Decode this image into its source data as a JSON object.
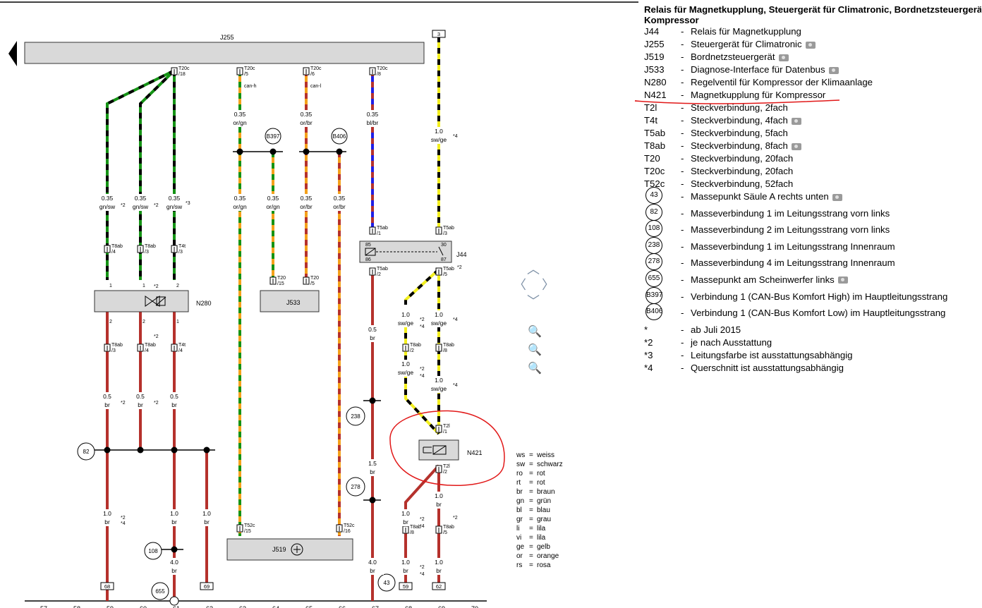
{
  "legend": {
    "title_line1": "Relais für Magnetkupplung, Steuergerät für Climatronic, Bordnetzsteuergerät",
    "title_line2": "Kompressor",
    "dash": "-",
    "items": [
      {
        "code": "J44",
        "desc": "Relais für Magnetkupplung",
        "photo": false
      },
      {
        "code": "J255",
        "desc": "Steuergerät für Climatronic",
        "photo": true
      },
      {
        "code": "J519",
        "desc": "Bordnetzsteuergerät",
        "photo": true
      },
      {
        "code": "J533",
        "desc": "Diagnose-Interface für Datenbus",
        "photo": true
      },
      {
        "code": "N280",
        "desc": "Regelventil für Kompressor der Klimaanlage",
        "photo": false
      },
      {
        "code": "N421",
        "desc": "Magnetkupplung für Kompressor",
        "photo": false
      },
      {
        "code": "T2l",
        "desc": "Steckverbindung, 2fach",
        "photo": false
      },
      {
        "code": "T4t",
        "desc": "Steckverbindung, 4fach",
        "photo": true
      },
      {
        "code": "T5ab",
        "desc": "Steckverbindung, 5fach",
        "photo": false
      },
      {
        "code": "T8ab",
        "desc": "Steckverbindung, 8fach",
        "photo": true
      },
      {
        "code": "T20",
        "desc": "Steckverbindung, 20fach",
        "photo": false
      },
      {
        "code": "T20c",
        "desc": "Steckverbindung, 20fach",
        "photo": false
      },
      {
        "code": "T52c",
        "desc": "Steckverbindung, 52fach",
        "photo": false
      }
    ],
    "ground_items": [
      {
        "code": "43",
        "desc": "Massepunkt Säule A rechts unten",
        "photo": true
      },
      {
        "code": "82",
        "desc": "Masseverbindung 1 im Leitungsstrang vorn links",
        "photo": false
      },
      {
        "code": "108",
        "desc": "Masseverbindung 2 im Leitungsstrang vorn links",
        "photo": false
      },
      {
        "code": "238",
        "desc": "Masseverbindung 1 im Leitungsstrang Innenraum",
        "photo": false
      },
      {
        "code": "278",
        "desc": "Masseverbindung 4 im Leitungsstrang Innenraum",
        "photo": false
      },
      {
        "code": "655",
        "desc": "Massepunkt am Scheinwerfer links",
        "photo": true
      },
      {
        "code": "B397",
        "desc": "Verbindung 1 (CAN-Bus Komfort High) im Hauptleitungsstrang",
        "photo": false
      },
      {
        "code": "B406",
        "desc": "Verbindung 1 (CAN-Bus Komfort Low) im Hauptleitungsstrang",
        "photo": false
      }
    ],
    "notes": [
      {
        "code": "*",
        "desc": "ab Juli 2015"
      },
      {
        "code": "*2",
        "desc": "je nach Ausstattung"
      },
      {
        "code": "*3",
        "desc": "Leitungsfarbe ist ausstattungsabhängig"
      },
      {
        "code": "*4",
        "desc": "Querschnitt ist ausstattungsabhängig"
      }
    ]
  },
  "color_key": [
    {
      "abbr": "ws",
      "name": "weiss"
    },
    {
      "abbr": "sw",
      "name": "schwarz"
    },
    {
      "abbr": "ro",
      "name": "rot"
    },
    {
      "abbr": "rt",
      "name": "rot"
    },
    {
      "abbr": "br",
      "name": "braun"
    },
    {
      "abbr": "gn",
      "name": "grün"
    },
    {
      "abbr": "bl",
      "name": "blau"
    },
    {
      "abbr": "gr",
      "name": "grau"
    },
    {
      "abbr": "li",
      "name": "lila"
    },
    {
      "abbr": "vi",
      "name": "lila"
    },
    {
      "abbr": "ge",
      "name": "gelb"
    },
    {
      "abbr": "or",
      "name": "orange"
    },
    {
      "abbr": "rs",
      "name": "rosa"
    }
  ],
  "diagram": {
    "components": {
      "j255": "J255",
      "j533": "J533",
      "j519": "J519",
      "j44": "J44",
      "n280": "N280",
      "n421": "N421"
    },
    "top_refs": {
      "r3": "3"
    },
    "bottom_refs": {
      "r68": "68",
      "r69": "69",
      "r59": "59",
      "r62": "62"
    },
    "grounds": {
      "g82": "82",
      "g108": "108",
      "g655": "655",
      "g238": "238",
      "g278": "278",
      "g43": "43"
    },
    "splices": {
      "b397": "B397",
      "b406": "B406"
    },
    "conn": {
      "t20c_18_a": "T20c",
      "t20c_18_b": "/18",
      "t20c_5_a": "T20c",
      "t20c_5_b": "/5",
      "t20c_5_c": "can-h",
      "t20c_6_a": "T20c",
      "t20c_6_b": "/6",
      "t20c_6_c": "can-l",
      "t20c_8_a": "T20c",
      "t20c_8_b": "/8",
      "t8ab_4": "T8ab",
      "t8ab_4_p": "/4",
      "t8ab_3": "T8ab",
      "t8ab_3_p": "/3",
      "t4t_3": "T4t",
      "t4t_3_p": "/3",
      "t8ab_3b": "T8ab",
      "t8ab_3b_p": "/3",
      "t8ab_4b": "T8ab",
      "t8ab_4b_p": "/4",
      "t4t_4": "T4t",
      "t4t_4_p": "/4",
      "t20_15": "T20",
      "t20_15_p": "/15",
      "t20_5": "T20",
      "t20_5_p": "/5",
      "t5ab_1": "T5ab",
      "t5ab_1_p": "/1",
      "t5ab_3": "T5ab",
      "t5ab_3_p": "/3",
      "t5ab_2": "T5ab",
      "t5ab_2_p": "/2",
      "t5ab_5": "T5ab",
      "t5ab_5_p": "/5",
      "t8ab_2": "T8ab",
      "t8ab_2_p": "/2",
      "t8ab_8": "T8ab",
      "t8ab_8_p": "/8",
      "t2l_1": "T2l",
      "t2l_1_p": "/1",
      "t2l_2": "T2l",
      "t2l_2_p": "/2",
      "t8ab_8b": "T8ab",
      "t8ab_8b_p": "/8",
      "t8ab_5": "T8ab",
      "t8ab_5_p": "/5",
      "t52c_15": "T52c",
      "t52c_15_p": "/15",
      "t52c_16": "T52c",
      "t52c_16_p": "/16"
    },
    "pins": {
      "p85": "85",
      "p86": "86",
      "p30": "30",
      "p87": "87",
      "n280_1a": "1",
      "n280_1b": "1",
      "n280_2": "2",
      "n280_2a": "2",
      "n280_2b": "2",
      "n280_1c": "1"
    },
    "wires": {
      "w1_s": "0.35",
      "w1_c": "gn/sw",
      "w2_s": "0.35",
      "w2_c": "gn/sw",
      "w3_s": "0.35",
      "w3_c": "gn/sw",
      "w4_s": "0.35",
      "w4_c": "or/gn",
      "w5_s": "0.35",
      "w5_c": "or/br",
      "w6_s": "0.35",
      "w6_c": "bl/br",
      "w7_s": "0.35",
      "w7_c": "or/gn",
      "w8_s": "0.35",
      "w8_c": "or/gn",
      "w9_s": "0.35",
      "w9_c": "or/br",
      "w10_s": "0.35",
      "w10_c": "or/br",
      "w11_s": "1.0",
      "w11_c": "sw/ge",
      "w12_s": "0.5",
      "w12_c": "br",
      "w13_s": "0.5",
      "w13_c": "br",
      "w14_s": "0.5",
      "w14_c": "br",
      "w15_s": "0.5",
      "w15_c": "br",
      "w16_s": "1.0",
      "w16_c": "sw/ge",
      "w17_s": "1.0",
      "w17_c": "sw/ge",
      "w18_s": "1.0",
      "w18_c": "sw/ge",
      "w19_s": "1.0",
      "w19_c": "sw/ge",
      "w20_s": "1.5",
      "w20_c": "br",
      "w21_s": "1.0",
      "w21_c": "br",
      "w22_s": "1.0",
      "w22_c": "br",
      "w23_s": "1.0",
      "w23_c": "br",
      "w24_s": "1.0",
      "w24_c": "br",
      "w25_s": "4.0",
      "w25_c": "br",
      "w26_s": "4.0",
      "w26_c": "br",
      "w27_s": "1.0",
      "w27_c": "br",
      "w28_s": "1.0",
      "w28_c": "br",
      "w29_s": "1.0",
      "w29_c": "br"
    },
    "notes": {
      "n1": "*2",
      "n2": "*2",
      "n3": "*3",
      "n4": "*2",
      "n5": "*2",
      "n6": "*2",
      "n7": "*4",
      "n8": "*2",
      "n9": "*2",
      "n10": "*4",
      "n11": "*2",
      "n12": "*4",
      "n13": "*4",
      "n14": "*2",
      "n15": "*4",
      "n16": "*4",
      "n17": "*2",
      "n18": "*4",
      "n19": "*2",
      "n20": "*4",
      "n21": "*2",
      "n22": "*4",
      "n23": "*2"
    },
    "ruler": [
      "57",
      "58",
      "59",
      "60",
      "61",
      "62",
      "63",
      "64",
      "65",
      "66",
      "67",
      "68",
      "69",
      "70"
    ]
  },
  "colors": {
    "wire_brown": "#b5312c",
    "wire_green": "#159315",
    "wire_black": "#000000",
    "wire_orange": "#f4a11b",
    "wire_blue": "#1f1fe6",
    "wire_yellow": "#f3ef1f",
    "box_fill": "#d9d9d9",
    "annotation_red": "#e11818"
  }
}
